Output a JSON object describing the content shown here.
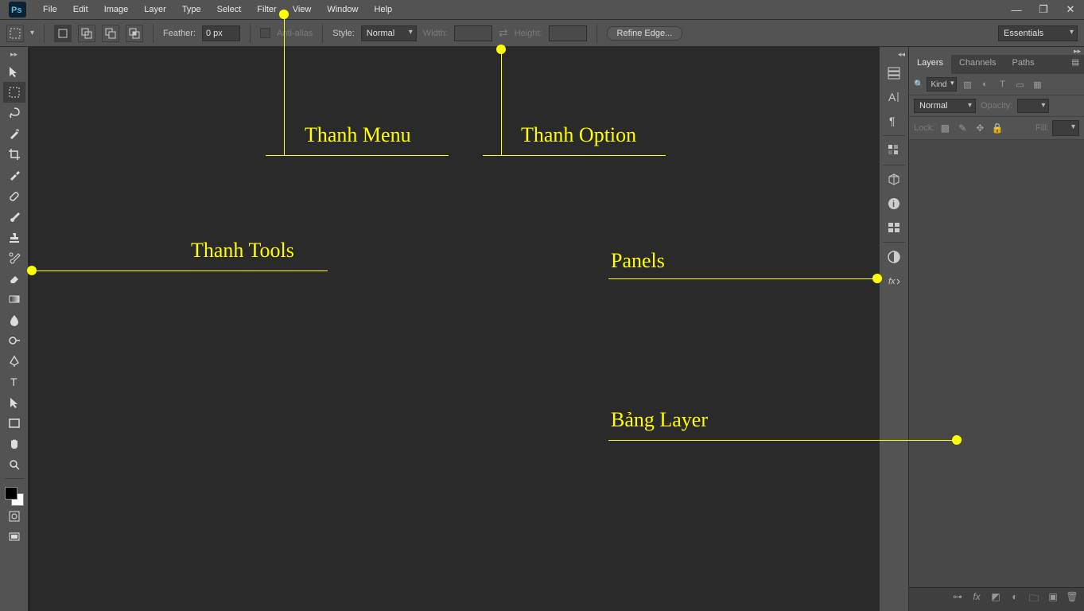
{
  "menu": {
    "items": [
      "File",
      "Edit",
      "Image",
      "Layer",
      "Type",
      "Select",
      "Filter",
      "View",
      "Window",
      "Help"
    ]
  },
  "options": {
    "feather_label": "Feather:",
    "feather_value": "0 px",
    "antialias_label": "Anti-alias",
    "style_label": "Style:",
    "style_value": "Normal",
    "width_label": "Width:",
    "height_label": "Height:",
    "refine_label": "Refine Edge...",
    "workspace": "Essentials"
  },
  "layers": {
    "tabs": [
      "Layers",
      "Channels",
      "Paths"
    ],
    "kind_label": "Kind",
    "blend_mode": "Normal",
    "opacity_label": "Opacity:",
    "lock_label": "Lock:",
    "fill_label": "Fill:"
  },
  "annotations": {
    "menu": "Thanh Menu",
    "option": "Thanh Option",
    "tools": "Thanh Tools",
    "panels": "Panels",
    "layer_panel": "Bảng Layer"
  }
}
